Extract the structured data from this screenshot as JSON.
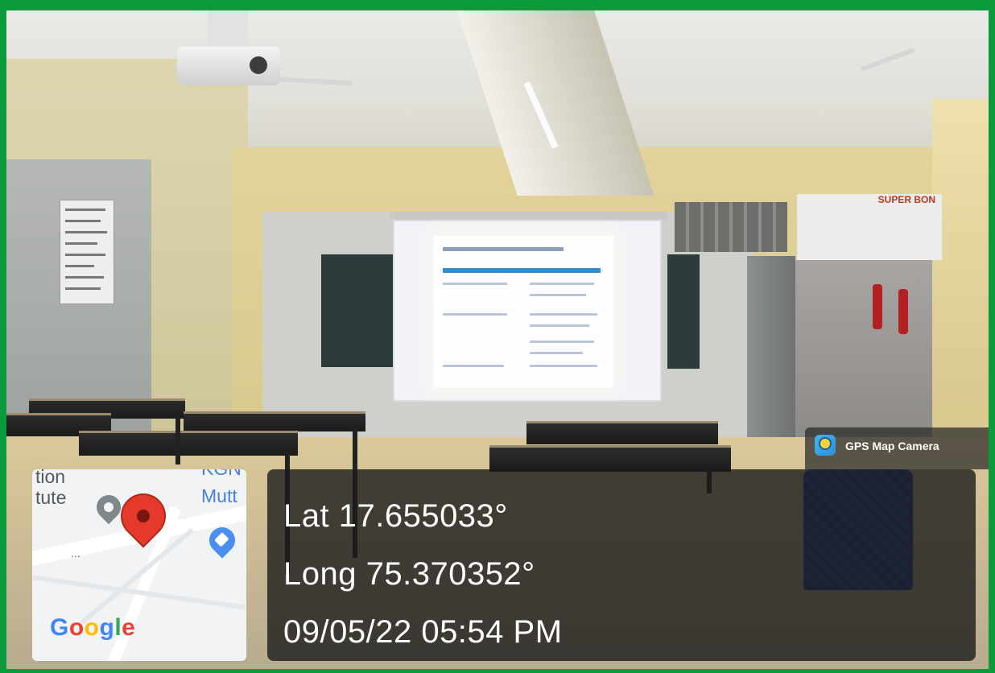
{
  "overlay": {
    "app_badge": {
      "label": "GPS Map Camera",
      "icon": "gps-map-camera-app-icon"
    },
    "coordinates": {
      "latitude": "Lat 17.655033°",
      "longitude": "Long 75.370352°",
      "datetime": "09/05/22 05:54 PM"
    },
    "map": {
      "label_top_left_1": "tion",
      "label_top_left_2": "tute",
      "label_top_right_1": "KGN",
      "label_top_right_2": "Mutt",
      "more": "...",
      "google_logo": {
        "letters": [
          "G",
          "o",
          "o",
          "g",
          "l",
          "e"
        ],
        "colors": [
          "#4285F4",
          "#EA4335",
          "#FBBC05",
          "#4285F4",
          "#34A853",
          "#EA4335"
        ]
      },
      "pin_color": "#e4392b",
      "icons": [
        "location-pin-icon",
        "place-pin-icon",
        "shopping-bag-pin-icon"
      ]
    },
    "colors": {
      "border": "#0a9a3c",
      "panel_text": "#ffffff"
    }
  },
  "scene": {
    "boxes_text": "SUPER BON"
  }
}
